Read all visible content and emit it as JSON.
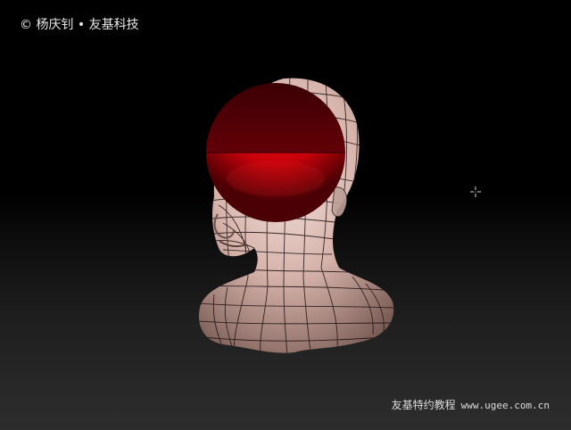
{
  "watermark": {
    "copyright_text": "© 杨庆钊 • 友基科技"
  },
  "footer": {
    "label": "友基特约教程",
    "url": "www.ugee.com.cn"
  },
  "colors": {
    "sphere_top": "#7a0008",
    "sphere_bottom": "#e0000b",
    "skin": "#d8b8b0",
    "wire": "#1a1010"
  },
  "cursor": {
    "icon": "crosshair-cursor-icon"
  }
}
